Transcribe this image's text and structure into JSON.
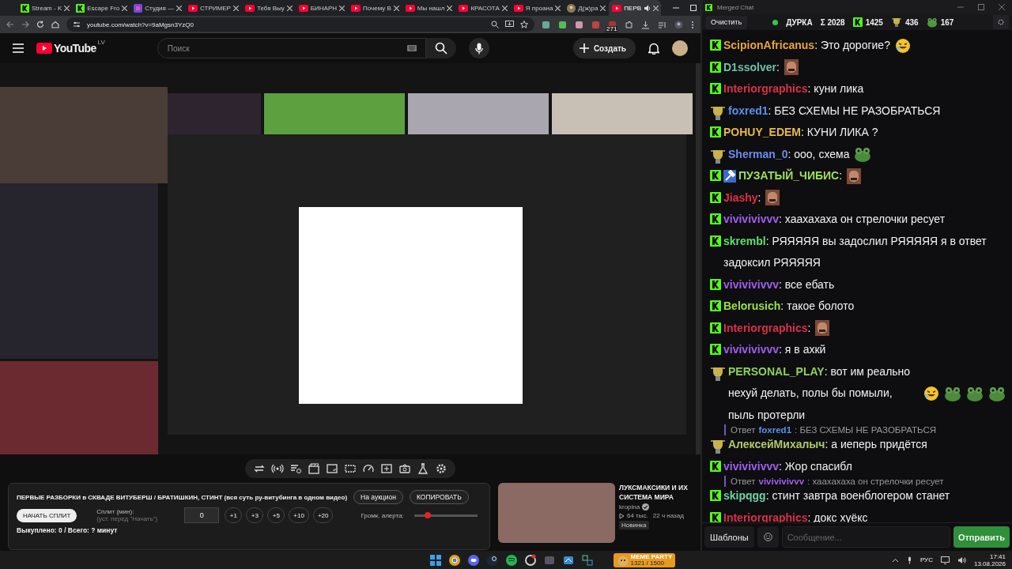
{
  "browser": {
    "tabs": [
      {
        "title": "Stream - K",
        "kind": "kick",
        "selected": false
      },
      {
        "title": "Escape Fro",
        "kind": "kick",
        "selected": false
      },
      {
        "title": "Студия —",
        "kind": "studio",
        "selected": false
      },
      {
        "title": "СТРИМЕР",
        "kind": "youtube",
        "selected": false
      },
      {
        "title": "Тебя Выу",
        "kind": "youtube",
        "selected": false
      },
      {
        "title": "БИНАРН",
        "kind": "youtube",
        "selected": false
      },
      {
        "title": "Почему В",
        "kind": "youtube",
        "selected": false
      },
      {
        "title": "Мы нашл",
        "kind": "youtube",
        "selected": false
      },
      {
        "title": "КРАСОТА",
        "kind": "youtube",
        "selected": false
      },
      {
        "title": "Я проана",
        "kind": "youtube",
        "selected": false
      },
      {
        "title": "Д(ж)ра",
        "kind": "avatar",
        "selected": false
      },
      {
        "title": "ПЕРВ",
        "kind": "youtube",
        "selected": true
      }
    ],
    "url": "youtube.com/watch?v=9aMgsn3YzQ0",
    "extension_badge": "271"
  },
  "youtube": {
    "logo": "YouTube",
    "region": "LV",
    "search": {
      "placeholder": "Поиск"
    },
    "create": "Создать"
  },
  "panel": {
    "title": "ПЕРВЫЕ РАЗБОРКИ в СКВАДЕ ВИТУБЕРШ / БРАТИШКИН, СТИНТ (вся суть ру-витубинга в одном видео)",
    "buttons": [
      "На аукцион",
      "КОПИРОВАТЬ"
    ],
    "start": "НАЧАТЬ СПЛИТ",
    "split_label": "Сплит (мин):",
    "split_hint": "(уст. перед \"Начать\")",
    "split_value": "0",
    "increments": [
      "+1",
      "+3",
      "+5",
      "+10",
      "+20"
    ],
    "volume_label": "Громк. алерта:",
    "volume": {
      "level": 0.22
    },
    "summary": "Выкуплено: 0 / Всего: ? минут"
  },
  "recommendation": {
    "title": "ЛУКСМАКСИКИ И ИХ СИСТЕМА МИРА",
    "channel": "kropina",
    "verified": true,
    "views": "64 тыс.",
    "age": "22 ч назад",
    "badge": "Новинка"
  },
  "chat": {
    "title": "Merged Chat",
    "clear": "Очистить",
    "channel": {
      "name": "ДУРКА",
      "live": true
    },
    "stats": [
      {
        "kind": "sum",
        "value": "Σ 2028"
      },
      {
        "kind": "kick",
        "value": "1425"
      },
      {
        "kind": "viewer",
        "value": "436"
      },
      {
        "kind": "frog",
        "value": "167"
      }
    ],
    "messages": [
      {
        "kind": "kick",
        "user": "ScipionAfricanus",
        "color": "#e8a33d",
        "text": ": Это дорогие?",
        "emotes": [
          {
            "kind": "laugh"
          }
        ]
      },
      {
        "kind": "kick",
        "user": "D1ssolver",
        "color": "#6fc1a8",
        "text": ":",
        "emotes": [
          {
            "kind": "face"
          }
        ]
      },
      {
        "kind": "kick",
        "user": "Interiorgraphics",
        "color": "#d9304a",
        "text": ": куни лика"
      },
      {
        "kind": "trophy",
        "user": "foxred1",
        "color": "#5b8ff0",
        "text": ": БЕЗ СХЕМЫ НЕ РАЗОБРАТЬСЯ"
      },
      {
        "kind": "kick",
        "user": "POHUY_EDEM",
        "color": "#e8b84a",
        "text": ": КУНИ ЛИКА ?"
      },
      {
        "kind": "trophy",
        "user": "Sherman_0",
        "color": "#6b8cf0",
        "text": ": ооо, схема",
        "emotes": [
          {
            "kind": "frog"
          }
        ]
      },
      {
        "kind": "kick",
        "moderator": true,
        "user": "ПУЗАТЫЙ_ЧИБИС",
        "color": "#9fe05a",
        "text": ":",
        "emotes": [
          {
            "kind": "face"
          }
        ]
      },
      {
        "kind": "kick",
        "user": "Jiashy",
        "color": "#e0304a",
        "text": ":",
        "emotes": [
          {
            "kind": "face"
          }
        ]
      },
      {
        "kind": "kick",
        "user": "vivivivivvv",
        "color": "#a35cf0",
        "text": ": хаахахаха он стрелочки ресует"
      },
      {
        "kind": "kick",
        "user": "skrembl",
        "color": "#5fe06a",
        "text": ": РЯЯЯЯЯ вы задослил РЯЯЯЯЯ я в ответ задоксил РЯЯЯЯЯ"
      },
      {
        "kind": "kick",
        "user": "vivivivivvv",
        "color": "#a35cf0",
        "text": ": все ебать"
      },
      {
        "kind": "kick",
        "user": "Belorusich",
        "color": "#9be04a",
        "text": ": такое болото"
      },
      {
        "kind": "kick",
        "user": "Interiorgraphics",
        "color": "#d9304a",
        "text": ":",
        "emotes": [
          {
            "kind": "face"
          }
        ]
      },
      {
        "kind": "kick",
        "user": "vivivivivvv",
        "color": "#a35cf0",
        "text": ": я в ахкй"
      },
      {
        "kind": "trophy",
        "user": "PERSONAL_PLAY",
        "color": "#8fd05a",
        "text": ": вот им реально нехуй делать, полы бы помыли, пыль протерли",
        "emotes": [
          {
            "kind": "laugh"
          },
          {
            "kind": "frog"
          },
          {
            "kind": "frog"
          },
          {
            "kind": "frog"
          }
        ]
      },
      {
        "kind": "reply",
        "label": "Ответ",
        "user": "foxred1",
        "color": "#5b8ff0",
        "text": ": БЕЗ СХЕМЫ НЕ РАЗОБРАТЬСЯ"
      },
      {
        "kind": "trophy",
        "user": "АлексейМихалыч",
        "color": "#b0c86a",
        "text": ": а иеперь придётся"
      },
      {
        "kind": "kick",
        "user": "vivivivivvv",
        "color": "#a35cf0",
        "text": ": Жор спасибл"
      },
      {
        "kind": "reply",
        "label": "Ответ",
        "user": "vivivivivvv",
        "color": "#a35cf0",
        "text": ": хаахахаха он стрелочки ресует"
      },
      {
        "kind": "kick",
        "user": "skipqgg",
        "color": "#6fd0a0",
        "text": ": стинт завтра военблогером станет"
      },
      {
        "kind": "kick",
        "user": "Interiorgraphics",
        "color": "#d9304a",
        "text": ": докс хуёкс"
      }
    ],
    "templates": "Шаблоны",
    "input": {
      "placeholder": "Сообщение..."
    },
    "send": "Отправить"
  },
  "taskbar": {
    "widget": {
      "title": "MEME PARTY",
      "count": "1321 / 1500"
    },
    "language": "РУС",
    "time": "17:41",
    "date": "13.08.2026"
  }
}
